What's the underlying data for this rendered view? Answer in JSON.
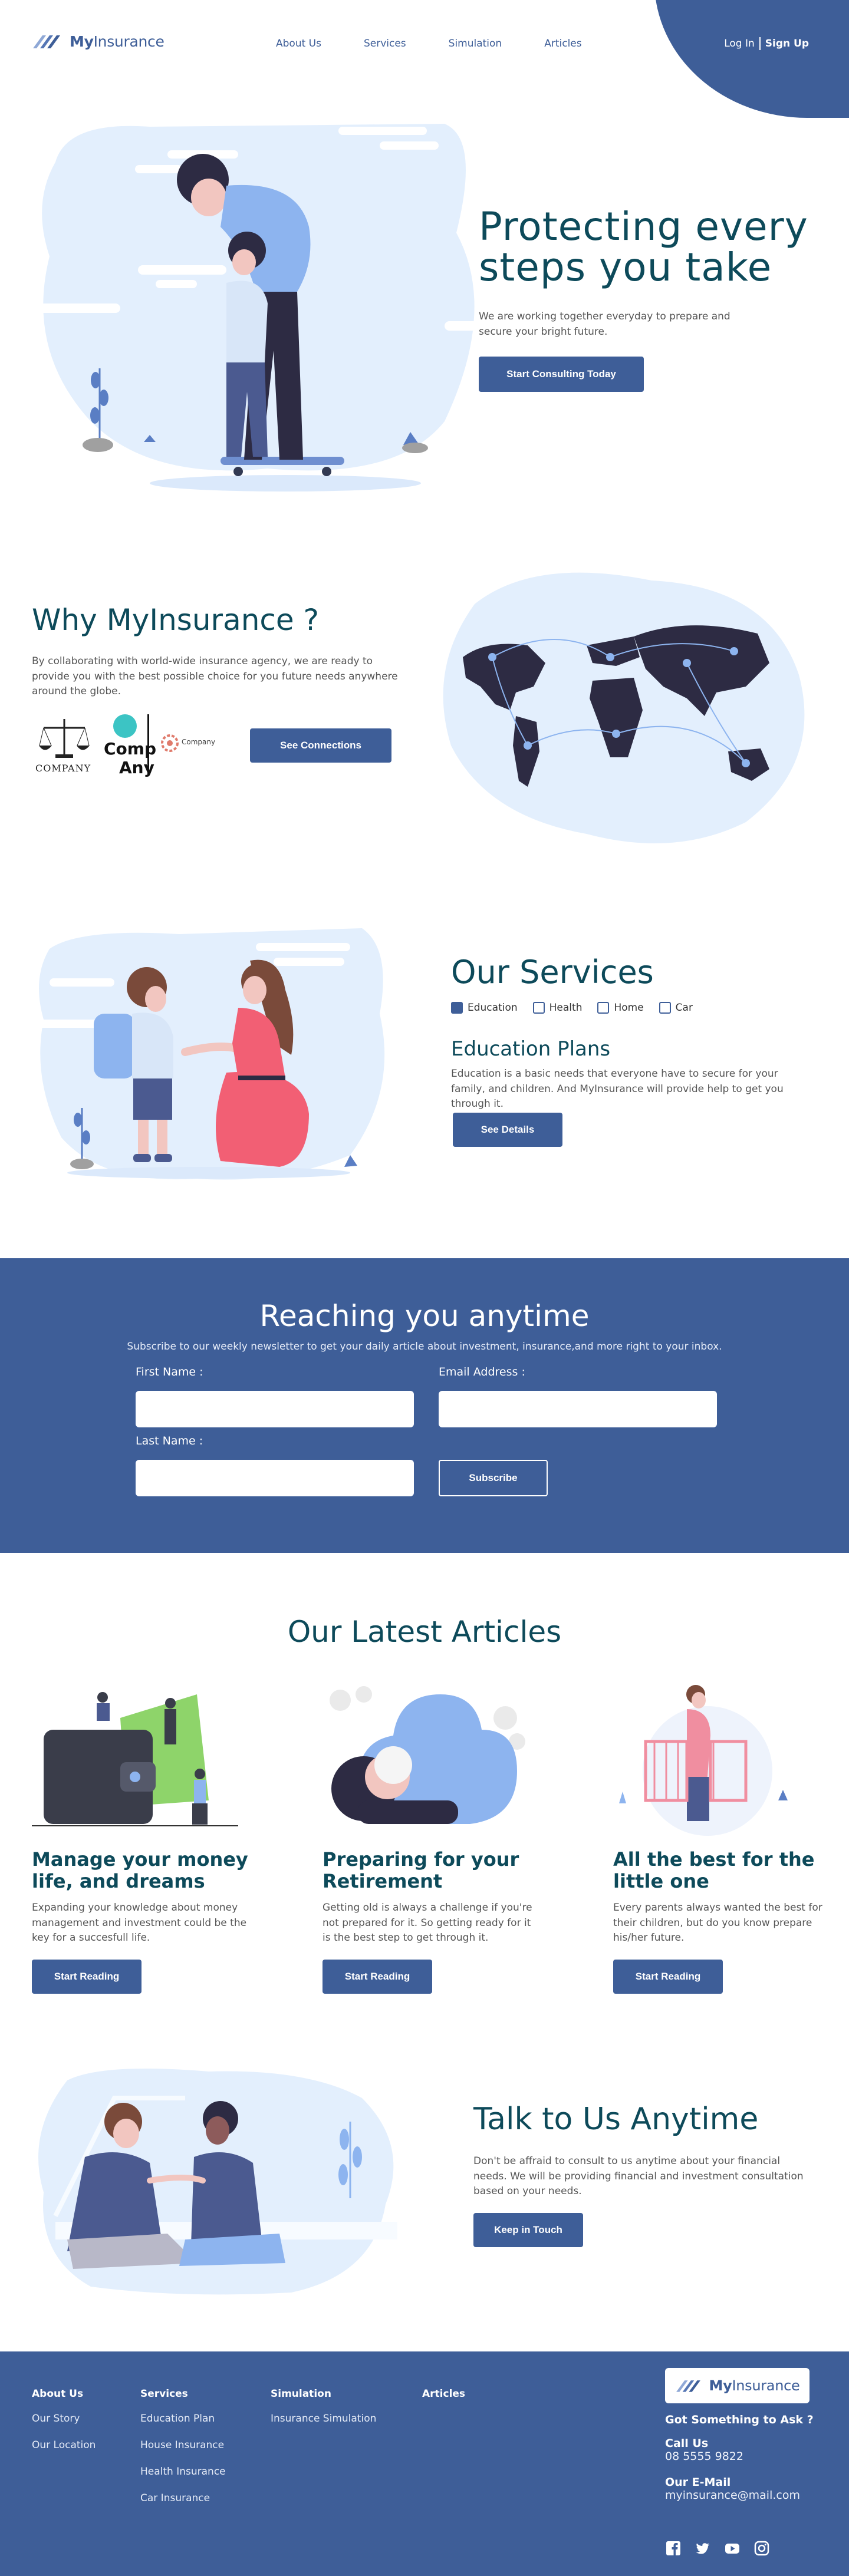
{
  "brand": {
    "name_bold": "My",
    "name_light": "Insurance"
  },
  "nav": {
    "items": [
      "About Us",
      "Services",
      "Simulation",
      "Articles"
    ]
  },
  "auth": {
    "login": "Log In",
    "signup": "Sign Up"
  },
  "hero": {
    "title": "Protecting every steps you take",
    "subtitle": "We are working together everyday to prepare and secure your bright future.",
    "cta": "Start Consulting Today"
  },
  "why": {
    "title": "Why MyInsurance ?",
    "subtitle": "By collaborating with world-wide insurance agency, we are ready to provide you with the best possible choice for you future needs anywhere around the globe.",
    "partners": [
      "COMPANY",
      "Comp",
      "Any",
      "Company"
    ],
    "cta": "See Connections"
  },
  "services": {
    "title": "Our Services",
    "tabs": [
      {
        "label": "Education",
        "checked": true
      },
      {
        "label": "Health",
        "checked": false
      },
      {
        "label": "Home",
        "checked": false
      },
      {
        "label": "Car",
        "checked": false
      }
    ],
    "plan_title": "Education Plans",
    "plan_text": "Education is a basic needs that everyone have to secure for your family, and children. And MyInsurance will provide help to get you through it.",
    "cta": "See Details"
  },
  "newsletter": {
    "title": "Reaching you anytime",
    "subtitle": "Subscribe to our weekly newsletter to get your daily article about investment, insurance,and more right to your inbox.",
    "first_name_label": "First Name :",
    "email_label": "Email Address :",
    "last_name_label": "Last Name :",
    "first_name_value": "",
    "email_value": "",
    "last_name_value": "",
    "subscribe": "Subscribe"
  },
  "articles": {
    "title": "Our Latest Articles",
    "items": [
      {
        "heading": "Manage your money life, and dreams",
        "text": "Expanding your knowledge about money management and investment could be the key for a succesfull life.",
        "cta": "Start Reading",
        "icon": "wallet-illustration"
      },
      {
        "heading": "Preparing for your Retirement",
        "text": "Getting old is always a challenge if you're not prepared for it. So getting ready for it is the best step to get through it.",
        "cta": "Start Reading",
        "icon": "retirement-illustration"
      },
      {
        "heading": "All the best for the little one",
        "text": "Every parents always wanted the best for their children, but do you know prepare his/her future.",
        "cta": "Start Reading",
        "icon": "baby-illustration"
      }
    ]
  },
  "talk": {
    "title": "Talk to Us Anytime",
    "text": "Don't be affraid to consult to us anytime about your financial needs. We will be providing financial and investment consultation based on your needs.",
    "cta": "Keep in Touch"
  },
  "footer": {
    "columns": [
      {
        "head": "About Us",
        "links": [
          "Our Story",
          "Our Location"
        ]
      },
      {
        "head": "Services",
        "links": [
          "Education Plan",
          "House Insurance",
          "Health Insurance",
          "Car Insurance"
        ]
      },
      {
        "head": "Simulation",
        "links": [
          "Insurance Simulation"
        ]
      },
      {
        "head": "Articles",
        "links": []
      }
    ],
    "contact_head": "Got Something to Ask ?",
    "call_label": "Call Us",
    "call_value": "08 5555 9822",
    "email_label": "Our E-Mail",
    "email_value": "myinsurance@mail.com",
    "socials": [
      "facebook-icon",
      "twitter-icon",
      "youtube-icon",
      "instagram-icon"
    ]
  },
  "colors": {
    "primary": "#3e5e98",
    "title": "#0d4a5a",
    "light_blue": "#e3effd"
  }
}
